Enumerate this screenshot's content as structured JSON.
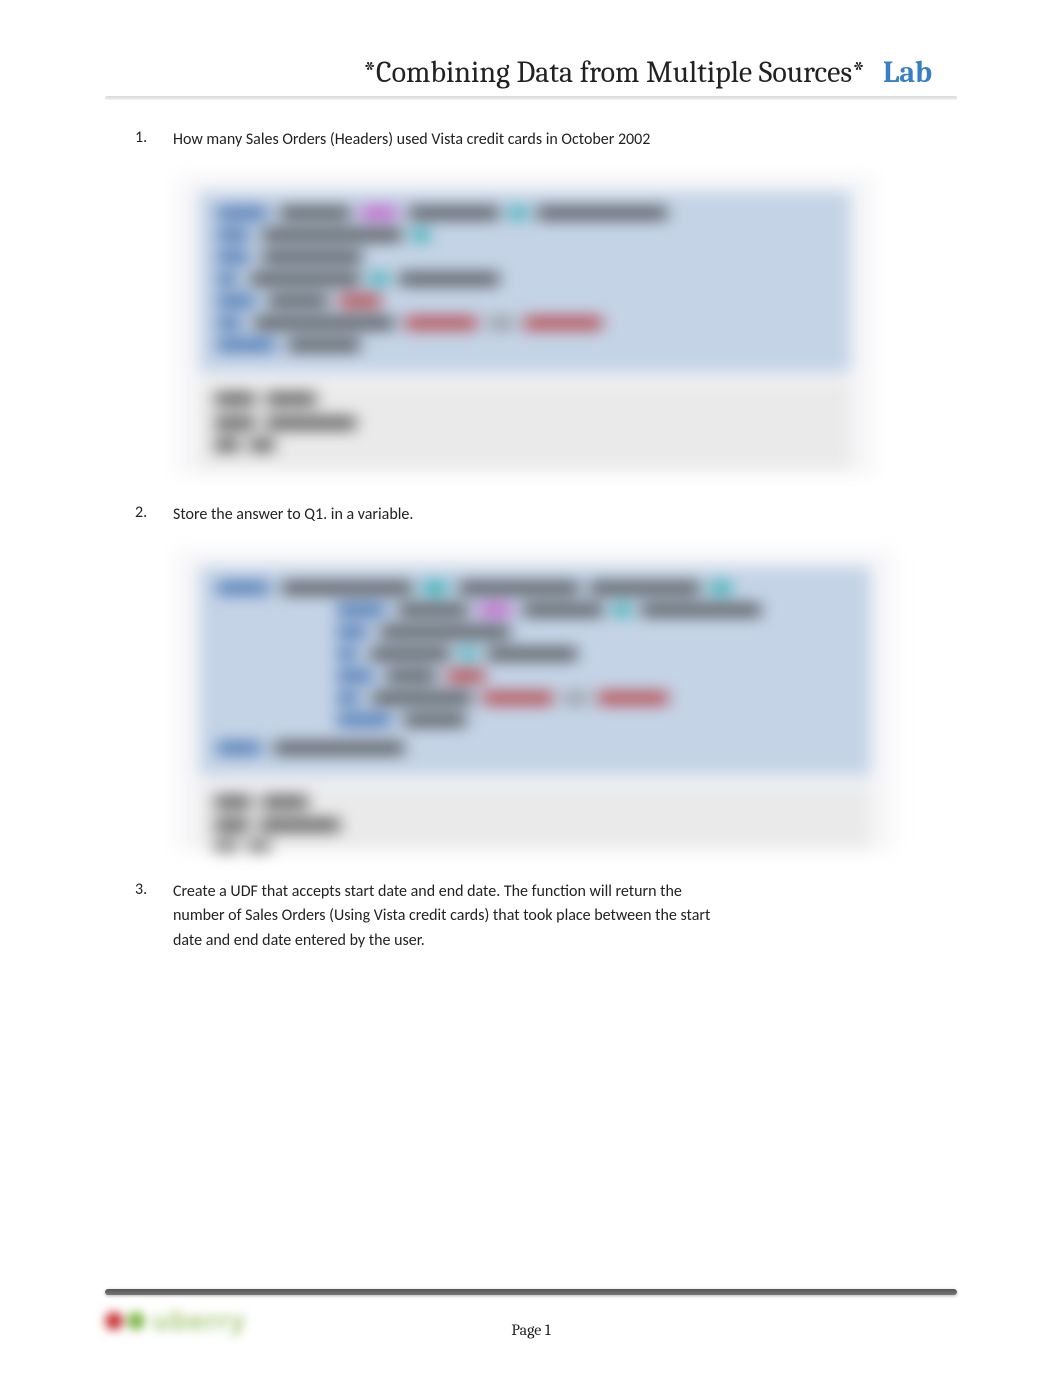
{
  "header": {
    "title": "*Combining Data from Multiple Sources*",
    "lab": "Lab"
  },
  "questions": [
    {
      "num": "1.",
      "text": "How many Sales Orders (Headers) used Vista credit cards in October 2002"
    },
    {
      "num": "2.",
      "text": "Store the answer to Q1. in a variable."
    },
    {
      "num": "3.",
      "text": "Create a UDF that accepts start date and end date. The function will return the number of Sales Orders (Using Vista credit cards) that took place between the start date and end date entered by the user."
    }
  ],
  "footer": {
    "page_label": "Page 1"
  }
}
